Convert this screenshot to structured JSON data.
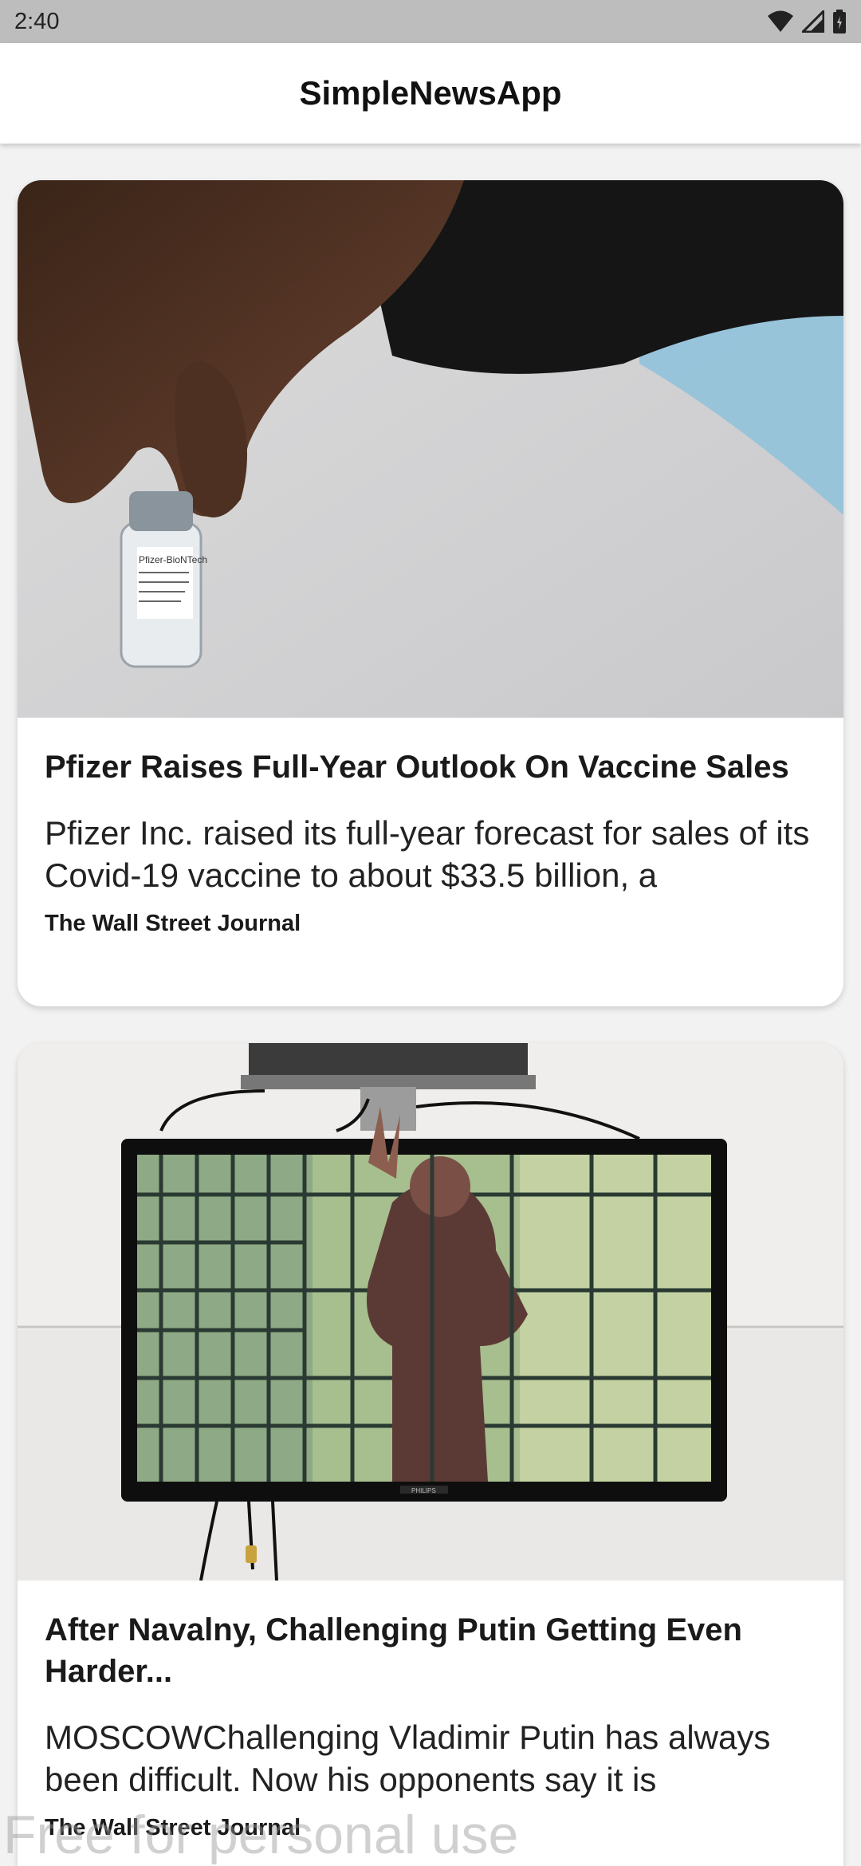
{
  "status_bar": {
    "time": "2:40",
    "icons": [
      "wifi-icon",
      "cellular-signal-icon",
      "battery-icon"
    ]
  },
  "app_bar": {
    "title": "SimpleNewsApp"
  },
  "articles": [
    {
      "title": "Pfizer Raises Full-Year Outlook On Vaccine Sales",
      "description": "Pfizer Inc. raised its full-year forecast for sales of its Covid-19 vaccine to about $33.5 billion, a",
      "source": "The Wall Street Journal",
      "image_alt": "Hand holding a Pfizer-BioNTech vaccine vial",
      "vial_label": "Pfizer-BioNTech"
    },
    {
      "title": "After Navalny, Challenging Putin Getting Even Harder...",
      "description": "MOSCOWChallenging Vladimir Putin has always been difficult. Now his opponents say it is",
      "source": "The Wall Street Journal",
      "image_alt": "TV screen showing a man behind bars",
      "tv_brand": "PHILIPS"
    }
  ],
  "watermark": "Free for personal use",
  "colors": {
    "status_bar_bg": "#bdbdbd",
    "app_bar_bg": "#ffffff",
    "feed_bg": "#f2f2f2",
    "card_bg": "#ffffff"
  }
}
